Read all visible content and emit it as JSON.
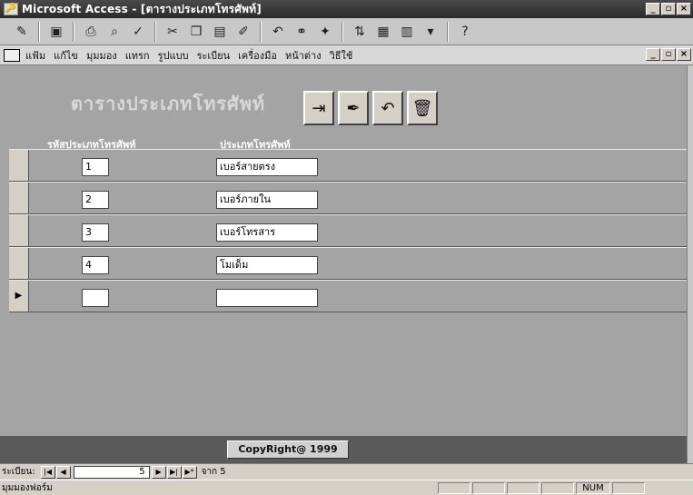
{
  "window": {
    "title": "Microsoft Access - [ตารางประเภทโทรศัพท์]",
    "buttons": [
      "_",
      "▫",
      "×"
    ]
  },
  "toolbar": {
    "icons": [
      "view-icon",
      "save-icon",
      "print-icon",
      "print-preview-icon",
      "spell-check-icon",
      "cut-icon",
      "copy-icon",
      "paste-icon",
      "format-painter-icon",
      "undo-icon",
      "insert-hyperlink-icon",
      "web-icon",
      "sort-icon",
      "filter-icon",
      "database-window-icon",
      "new-object-icon",
      "help-icon"
    ]
  },
  "menu": {
    "items": [
      "แฟ้ม",
      "แก้ไข",
      "มุมมอง",
      "แทรก",
      "รูปแบบ",
      "ระเบียน",
      "เครื่องมือ",
      "หน้าต่าง",
      "วิธีใช้"
    ]
  },
  "form": {
    "title": "ตารางประเภทโทรศัพท์",
    "columns": {
      "code": "รหัสประเภทโทรศัพท์",
      "type": "ประเภทโทรศัพท์"
    },
    "rows": [
      {
        "code": "1",
        "type": "เบอร์สายตรง"
      },
      {
        "code": "2",
        "type": "เบอร์ภายใน"
      },
      {
        "code": "3",
        "type": "เบอร์โทรสาร"
      },
      {
        "code": "4",
        "type": "โมเด็ม"
      },
      {
        "code": "",
        "type": "",
        "new": true
      }
    ],
    "new_row_marker": "▶",
    "footer": "CopyRight@ 1999"
  },
  "navigation": {
    "label": "ระเบียน:",
    "current_record": "5",
    "of_label": "จาก 5"
  },
  "status": {
    "text": "มุมมองฟอร์ม",
    "num": "NUM"
  }
}
